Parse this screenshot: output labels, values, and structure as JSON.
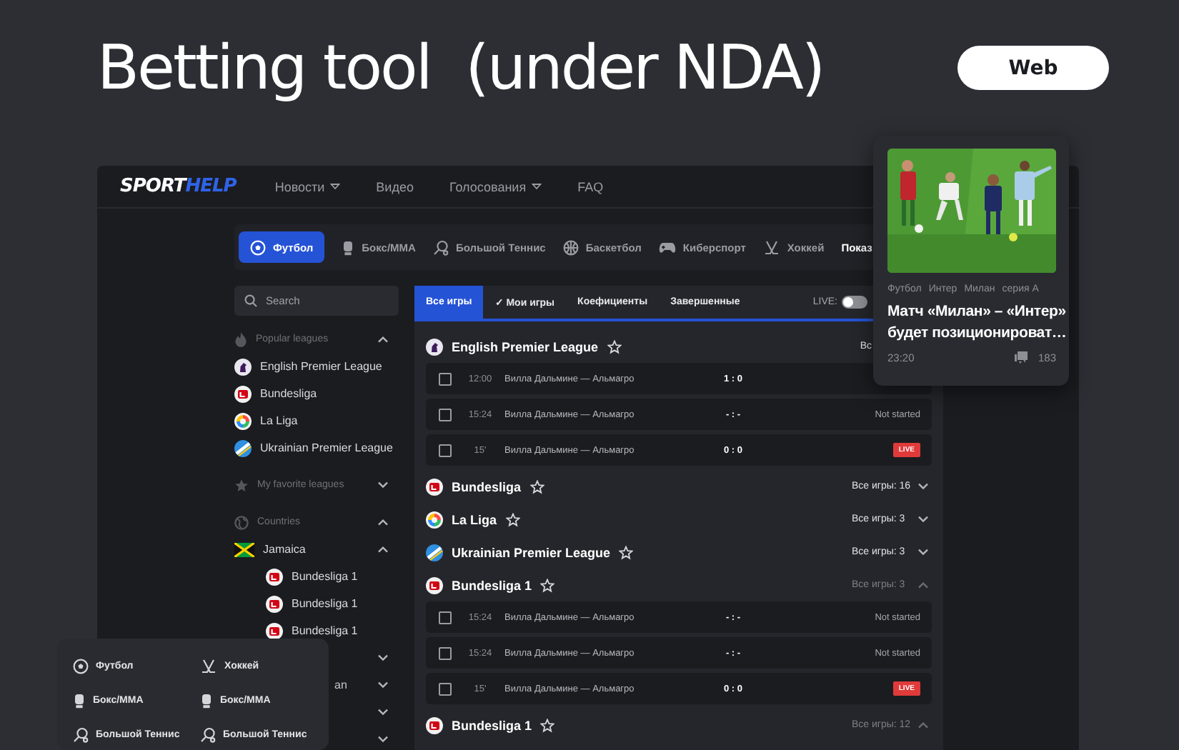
{
  "title": "Betting tool  (under NDA)",
  "platform_button": "Web",
  "app": {
    "logo": {
      "part_1": "SPORT",
      "part_2": "HELP"
    },
    "nav": [
      {
        "label": "Новости",
        "dropdown": true
      },
      {
        "label": "Видео",
        "dropdown": false
      },
      {
        "label": "Голосования",
        "dropdown": true
      },
      {
        "label": "FAQ",
        "dropdown": false
      }
    ],
    "sports_tabs": [
      {
        "label": "Футбол",
        "kind": "football",
        "selected": true
      },
      {
        "label": "Бокс/ММА",
        "kind": "boxing",
        "selected": false
      },
      {
        "label": "Большой Теннис",
        "kind": "tennis",
        "selected": false
      },
      {
        "label": "Баскетбол",
        "kind": "basketball",
        "selected": false
      },
      {
        "label": "Киберспорт",
        "kind": "esports",
        "selected": false
      },
      {
        "label": "Хоккей",
        "kind": "hockey",
        "selected": false
      }
    ],
    "sports_more": "Показ",
    "search": {
      "placeholder": "Search"
    },
    "sidebar": [
      {
        "kind": "popular",
        "title": "Popular leagues",
        "expanded": true,
        "items": [
          {
            "label": "English Premier League",
            "kind": "epl"
          },
          {
            "label": "Bundesliga",
            "kind": "bundesliga"
          },
          {
            "label": "La Liga",
            "kind": "laliga"
          },
          {
            "label": "Ukrainian Premier League",
            "kind": "upl"
          }
        ]
      },
      {
        "kind": "favorite",
        "title": "My favorite leagues",
        "expanded": false
      },
      {
        "kind": "countries",
        "title": "Countries",
        "expanded": true,
        "items": [
          {
            "label": "Jamaica",
            "kind": "jamaica",
            "expanded": true,
            "children": [
              {
                "label": "Bundesliga 1",
                "kind": "bundesliga"
              },
              {
                "label": "Bundesliga 1",
                "kind": "bundesliga"
              },
              {
                "label": "Bundesliga 1",
                "kind": "bundesliga"
              }
            ]
          },
          {
            "expanded": false
          },
          {
            "label": "an",
            "expanded": false
          },
          {
            "expanded": false
          },
          {
            "expanded": false
          }
        ]
      }
    ],
    "game_tabs": [
      {
        "label": "Все игры",
        "selected": true
      },
      {
        "mark": "✓",
        "label": "Мои игры",
        "selected": false
      },
      {
        "label": "Коефициенты",
        "selected": false
      },
      {
        "label": "Завершенные",
        "selected": false
      }
    ],
    "live_toggle": {
      "label": "LIVE:",
      "on": false
    },
    "leagues": [
      {
        "name": "English Premier League",
        "kind": "epl",
        "favorite": false,
        "count": "Вс",
        "matches": [
          {
            "checked": false,
            "time": "12:00",
            "teams": "Вилла Дальмине — Альмагро",
            "score": "1 : 0"
          },
          {
            "checked": false,
            "time": "15:24",
            "teams": "Вилла Дальмине — Альмагро",
            "score": "- : -",
            "status": {
              "kind": "text",
              "text": "Not started"
            }
          },
          {
            "checked": false,
            "time": "15'",
            "teams": "Вилла Дальмине — Альмагро",
            "score": "0 : 0",
            "status": {
              "kind": "live",
              "text": "LIVE"
            }
          }
        ]
      },
      {
        "name": "Bundesliga",
        "kind": "bundesliga",
        "favorite": false,
        "count": "Все игры: 16",
        "expanded": false
      },
      {
        "name": "La Liga",
        "kind": "laliga",
        "favorite": false,
        "count": "Все игры: 3",
        "expanded": false
      },
      {
        "name": "Ukrainian Premier League",
        "kind": "upl",
        "favorite": false,
        "count": "Все игры: 3",
        "expanded": false
      },
      {
        "name": "Bundesliga 1",
        "kind": "bundesliga",
        "favorite": false,
        "count": "Все игры: 3",
        "expanded": true,
        "matches": [
          {
            "checked": false,
            "time": "15:24",
            "teams": "Вилла Дальмине — Альмагро",
            "score": "- : -",
            "status": {
              "kind": "text",
              "text": "Not started"
            }
          },
          {
            "checked": false,
            "time": "15:24",
            "teams": "Вилла Дальмине — Альмагро",
            "score": "- : -",
            "status": {
              "kind": "text",
              "text": "Not started"
            }
          },
          {
            "checked": false,
            "time": "15'",
            "teams": "Вилла Дальмине — Альмагро",
            "score": "0 : 0",
            "status": {
              "kind": "live",
              "text": "LIVE"
            }
          }
        ]
      },
      {
        "name": "Bundesliga 1",
        "kind": "bundesliga",
        "favorite": false,
        "count": "Все игры: 12",
        "expanded": true
      }
    ]
  },
  "news_card": {
    "tags": [
      "Футбол",
      "Интер",
      "Милан",
      "серия А"
    ],
    "title": "Матч «Милан» – «Интер» будет позиционироват…",
    "time": "23:20",
    "comments": "183"
  },
  "sports_menu": [
    {
      "label": "Футбол",
      "kind": "football"
    },
    {
      "label": "Хоккей",
      "kind": "hockey"
    },
    {
      "label": "Бокс/ММА",
      "kind": "boxing"
    },
    {
      "label": "Бокс/ММА",
      "kind": "boxing"
    },
    {
      "label": "Большой Теннис",
      "kind": "tennis"
    },
    {
      "label": "Большой Теннис",
      "kind": "tennis"
    }
  ]
}
